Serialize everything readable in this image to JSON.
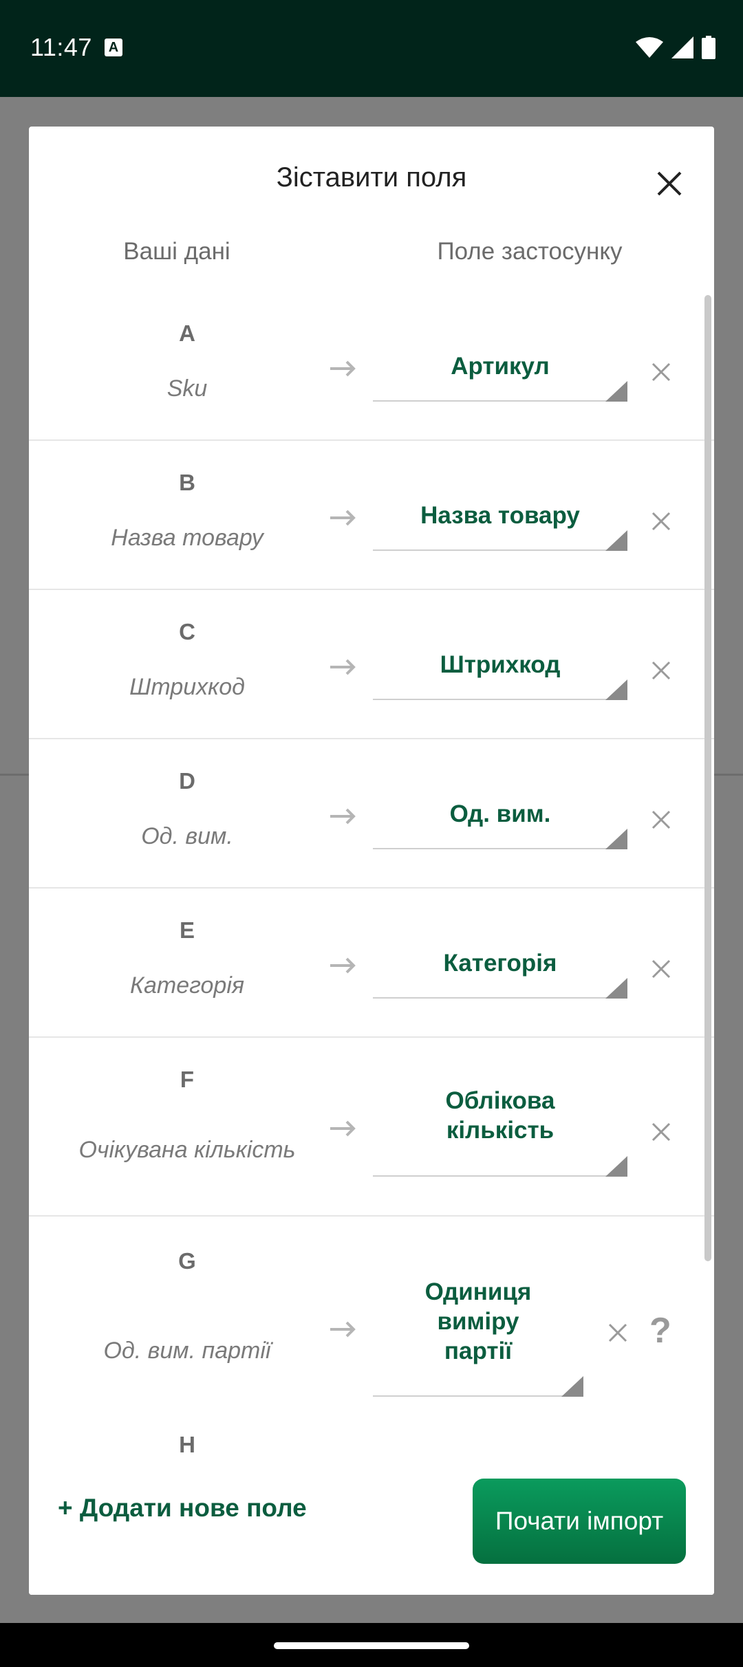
{
  "status_bar": {
    "time": "11:47",
    "notification_icon_letter": "A"
  },
  "dialog": {
    "title": "Зіставити поля",
    "col_left": "Ваші дані",
    "col_right": "Поле застосунку",
    "rows": [
      {
        "letter": "A",
        "source": "Sku",
        "target": "Артикул"
      },
      {
        "letter": "B",
        "source": "Назва товару",
        "target": "Назва товару"
      },
      {
        "letter": "C",
        "source": "Штрихкод",
        "target": "Штрихкод"
      },
      {
        "letter": "D",
        "source": "Од. вим.",
        "target": "Од. вим."
      },
      {
        "letter": "E",
        "source": "Категорія",
        "target": "Категорія"
      },
      {
        "letter": "F",
        "source": "Очікувана кількість",
        "target_lines": [
          "Облікова",
          "кількість"
        ]
      },
      {
        "letter": "G",
        "source": "Од. вим. партії",
        "target_lines": [
          "Одиниця",
          "виміру",
          "партії"
        ]
      },
      {
        "letter": "H"
      }
    ],
    "add_field_label": "+ Додати нове поле",
    "start_import_label": "Почати імпорт",
    "help_glyph": "?"
  },
  "colors": {
    "accent": "#0b5d3f",
    "button": "#05703f",
    "status_bar": "#01241a"
  }
}
